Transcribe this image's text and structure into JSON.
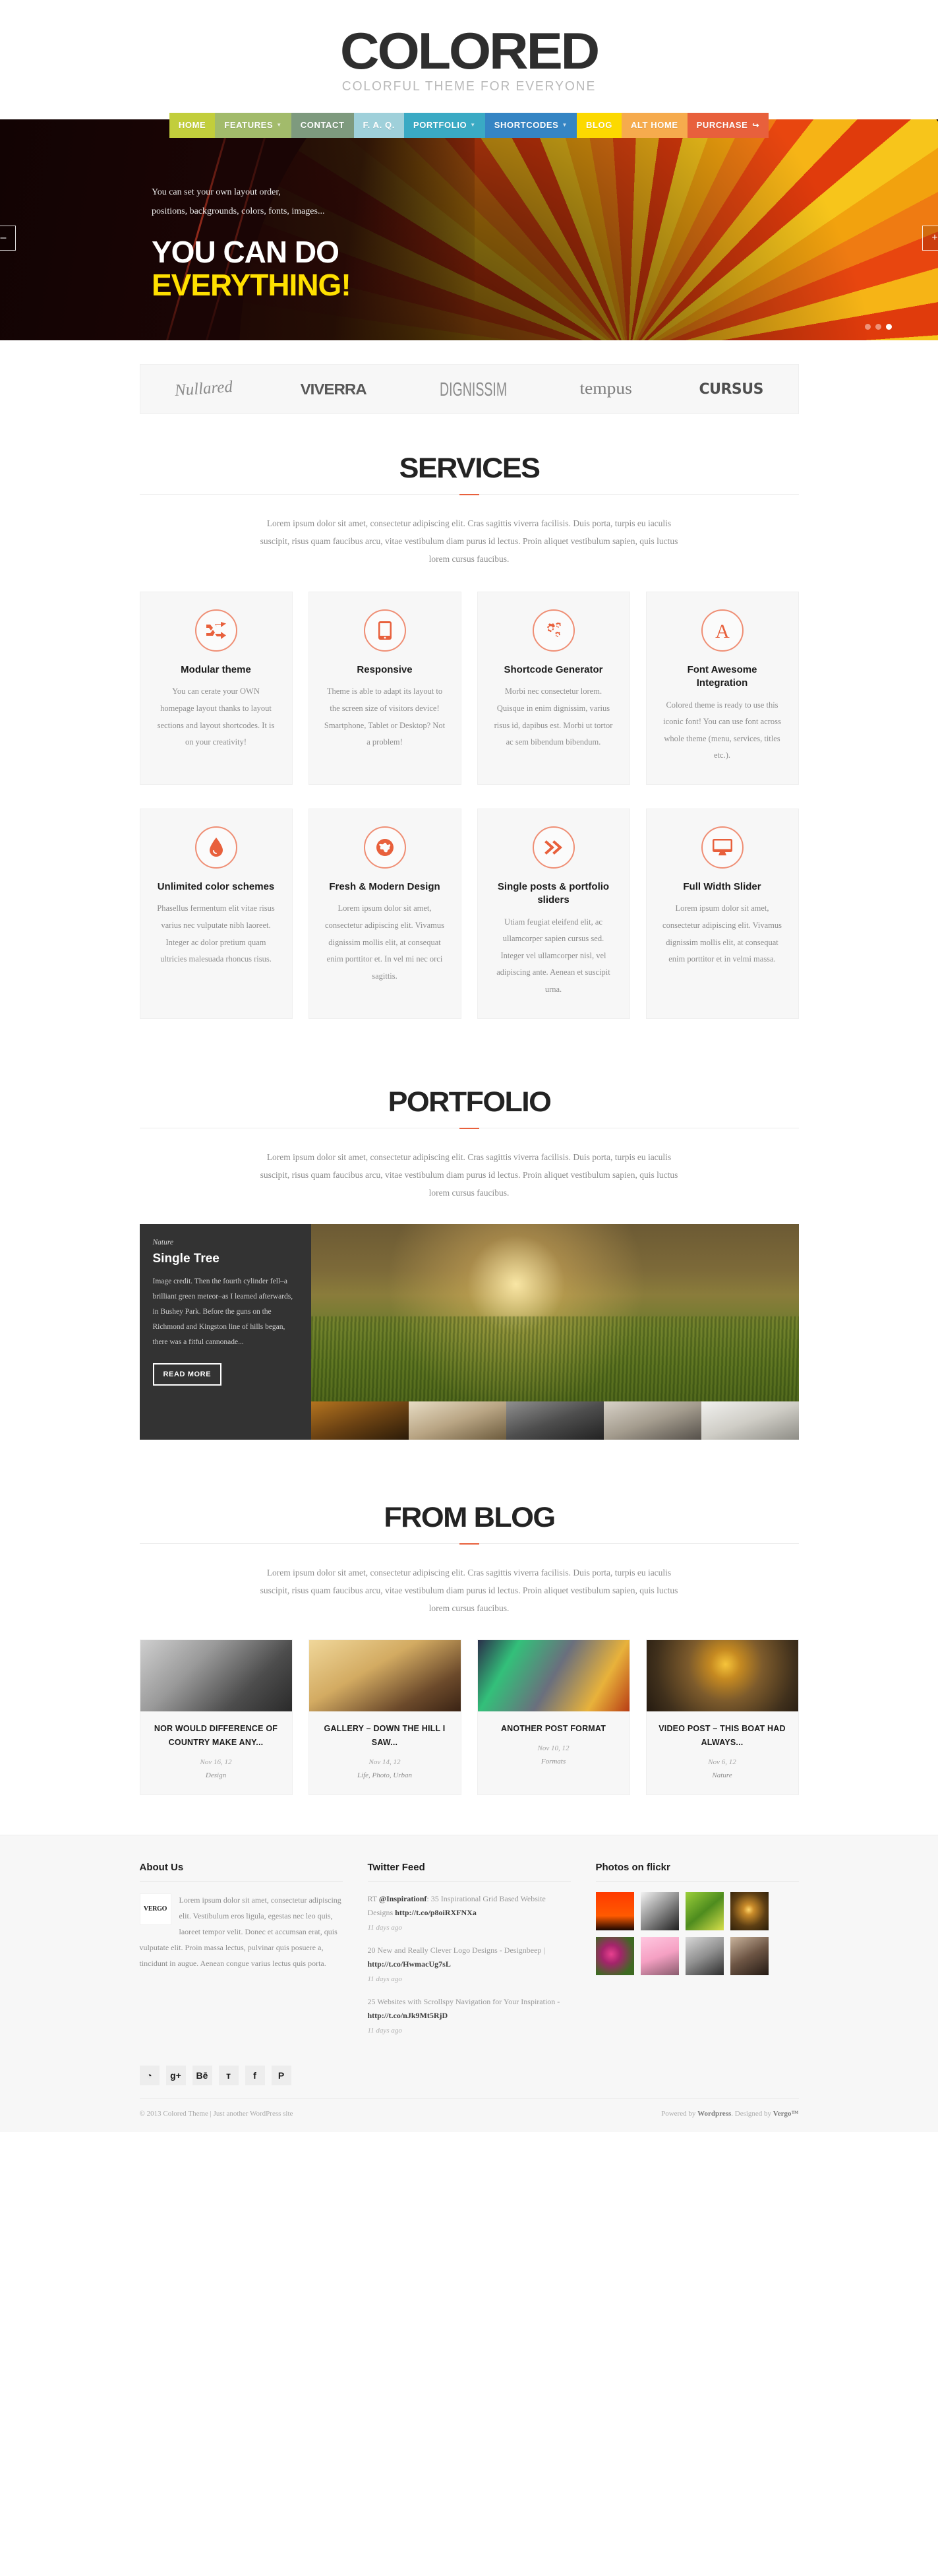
{
  "header": {
    "logo": "COLORED",
    "tagline": "COLORFUL THEME FOR EVERYONE"
  },
  "nav": {
    "items": [
      {
        "label": "HOME",
        "color": "#c2ce3c",
        "caret": false,
        "ext": false
      },
      {
        "label": "FEATURES",
        "color": "#a2bb6b",
        "caret": true,
        "ext": false
      },
      {
        "label": "CONTACT",
        "color": "#7e9a7e",
        "caret": false,
        "ext": false
      },
      {
        "label": "F. A. Q.",
        "color": "#9fd0da",
        "caret": false,
        "ext": false
      },
      {
        "label": "PORTFOLIO",
        "color": "#3aaac4",
        "caret": true,
        "ext": false
      },
      {
        "label": "SHORTCODES",
        "color": "#3585c4",
        "caret": true,
        "ext": false
      },
      {
        "label": "BLOG",
        "color": "#fcd900",
        "caret": false,
        "ext": false
      },
      {
        "label": "ALT HOME",
        "color": "#f6ab4d",
        "caret": false,
        "ext": false
      },
      {
        "label": "PURCHASE",
        "color": "#e8603c",
        "caret": false,
        "ext": true
      }
    ]
  },
  "slider": {
    "subtitle_line1": "You can set your own layout order,",
    "subtitle_line2": "positions, backgrounds, colors, fonts, images...",
    "headline_line1": "YOU CAN DO",
    "headline_line2": "EVERYTHING!",
    "prev_label": "–",
    "next_label": "+",
    "dots": [
      "1",
      "2",
      "3"
    ],
    "active_dot": 2,
    "highlight_color": "#ffe000"
  },
  "brands": [
    {
      "name": "Nullared"
    },
    {
      "name": "VIVERRA"
    },
    {
      "name": "DIGNISSIM"
    },
    {
      "name": "tempus"
    },
    {
      "name": "CURSUS"
    }
  ],
  "services": {
    "title": "SERVICES",
    "description": "Lorem ipsum dolor sit amet, consectetur adipiscing elit. Cras sagittis viverra facilisis. Duis porta, turpis eu iaculis suscipit, risus quam faucibus arcu, vitae vestibulum diam purus id lectus. Proin aliquet vestibulum sapien, quis luctus lorem cursus faucibus.",
    "accent_color": "#e8603c",
    "items": [
      {
        "icon": "shuffle-icon",
        "title": "Modular theme",
        "text": "You can cerate your OWN homepage layout thanks to layout sections and layout shortcodes. It is on your creativity!"
      },
      {
        "icon": "tablet-icon",
        "title": "Responsive",
        "text": "Theme is able to adapt its layout to the screen size of visitors device! Smartphone, Tablet or Desktop? Not a problem!"
      },
      {
        "icon": "gears-icon",
        "title": "Shortcode Generator",
        "text": "Morbi nec consectetur lorem. Quisque in enim dignissim, varius risus id, dapibus est. Morbi ut tortor ac sem bibendum bibendum."
      },
      {
        "icon": "letter-a-icon",
        "title": "Font Awesome Integration",
        "text": "Colored theme is ready to use this iconic font! You can use font across whole theme (menu, services, titles etc.)."
      },
      {
        "icon": "droplet-icon",
        "title": "Unlimited color schemes",
        "text": "Phasellus fermentum elit vitae risus varius nec vulputate nibh laoreet. Integer ac dolor pretium quam ultricies malesuada rhoncus risus."
      },
      {
        "icon": "globe-icon",
        "title": "Fresh & Modern Design",
        "text": "Lorem ipsum dolor sit amet, consectetur adipiscing elit. Vivamus dignissim mollis elit, at consequat enim porttitor et. In vel mi nec orci sagittis."
      },
      {
        "icon": "chevrons-icon",
        "title": "Single posts & portfolio sliders",
        "text": "Utiam feugiat eleifend elit, ac ullamcorper sapien cursus sed. Integer vel ullamcorper nisl, vel adipiscing ante. Aenean et suscipit urna."
      },
      {
        "icon": "desktop-icon",
        "title": "Full Width Slider",
        "text": "Lorem ipsum dolor sit amet, consectetur adipiscing elit. Vivamus dignissim mollis elit, at consequat enim porttitor et in velmi massa."
      }
    ]
  },
  "portfolio": {
    "title": "PORTFOLIO",
    "description": "Lorem ipsum dolor sit amet, consectetur adipiscing elit. Cras sagittis viverra facilisis. Duis porta, turpis eu iaculis suscipit, risus quam faucibus arcu, vitae vestibulum diam purus id lectus. Proin aliquet vestibulum sapien, quis luctus lorem cursus faucibus.",
    "featured": {
      "category": "Nature",
      "title": "Single Tree",
      "text": "Image credit. Then the fourth cylinder fell–a brilliant green meteor–as I learned afterwards, in Bushey Park. Before the guns on the Richmond and Kingston line of hills began, there was a fitful cannonade...",
      "button": "READ MORE"
    }
  },
  "blog": {
    "title": "FROM BLOG",
    "description": "Lorem ipsum dolor sit amet, consectetur adipiscing elit. Cras sagittis viverra facilisis. Duis porta, turpis eu iaculis suscipit, risus quam faucibus arcu, vitae vestibulum diam purus id lectus. Proin aliquet vestibulum sapien, quis luctus lorem cursus faucibus.",
    "posts": [
      {
        "title": "NOR WOULD DIFFERENCE OF COUNTRY MAKE ANY...",
        "date": "Nov 16, 12",
        "categories": "Design"
      },
      {
        "title": "GALLERY – DOWN THE HILL I SAW...",
        "date": "Nov 14, 12",
        "categories": "Life, Photo, Urban"
      },
      {
        "title": "ANOTHER POST FORMAT",
        "date": "Nov 10, 12",
        "categories": "Formats"
      },
      {
        "title": "VIDEO POST – THIS BOAT HAD ALWAYS...",
        "date": "Nov 6, 12",
        "categories": "Nature"
      }
    ]
  },
  "footer": {
    "about": {
      "heading": "About Us",
      "logo_text": "VERGO",
      "text": "Lorem ipsum dolor sit amet, consectetur adipiscing elit. Vestibulum eros ligula, egestas nec leo quis, laoreet tempor velit. Donec et accumsan erat, quis vulputate elit. Proin massa lectus, pulvinar quis posuere a, tincidunt in augue. Aenean congue varius lectus quis porta."
    },
    "twitter": {
      "heading": "Twitter Feed",
      "tweets": [
        {
          "prefix": "RT ",
          "handle": "@Inspirationf",
          "body": ": 35 Inspirational Grid Based Website Designs ",
          "link": "http://t.co/p8oiRXFNXa",
          "ago": "11 days ago"
        },
        {
          "prefix": "",
          "handle": "",
          "body": "20 New and Really Clever Logo Designs - Designbeep | ",
          "link": "http://t.co/HwmacUg7sL",
          "ago": "11 days ago"
        },
        {
          "prefix": "",
          "handle": "",
          "body": "25 Websites with Scrollspy Navigation for Your Inspiration - ",
          "link": "http://t.co/nJk9Mt5RjD",
          "ago": "11 days ago"
        }
      ]
    },
    "flickr": {
      "heading": "Photos on flickr",
      "count": 8
    },
    "social": [
      {
        "name": "rss-icon",
        "glyph": "◔"
      },
      {
        "name": "googleplus-icon",
        "glyph": "g+"
      },
      {
        "name": "behance-icon",
        "glyph": "Bē"
      },
      {
        "name": "twitter-icon",
        "glyph": "ᴛ"
      },
      {
        "name": "facebook-icon",
        "glyph": "f"
      },
      {
        "name": "pinterest-icon",
        "glyph": "P"
      }
    ],
    "copyright": "© 2013 Colored Theme | Just another WordPress site",
    "credits_prefix": "Powered by ",
    "credits_wp": "Wordpress",
    "credits_mid": ". Designed by ",
    "credits_author": "Vergo™"
  }
}
